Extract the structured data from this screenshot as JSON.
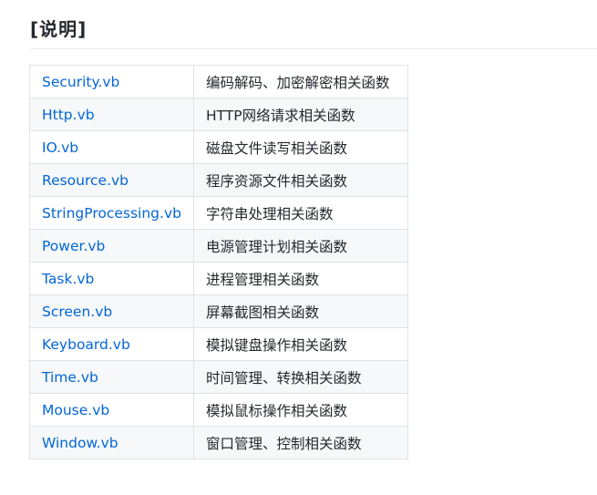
{
  "section": {
    "title": "[说明]"
  },
  "table": {
    "rows": [
      {
        "file": "Security.vb",
        "desc": "编码解码、加密解密相关函数"
      },
      {
        "file": "Http.vb",
        "desc": "HTTP网络请求相关函数"
      },
      {
        "file": "IO.vb",
        "desc": "磁盘文件读写相关函数"
      },
      {
        "file": "Resource.vb",
        "desc": "程序资源文件相关函数"
      },
      {
        "file": "StringProcessing.vb",
        "desc": "字符串处理相关函数"
      },
      {
        "file": "Power.vb",
        "desc": "电源管理计划相关函数"
      },
      {
        "file": "Task.vb",
        "desc": "进程管理相关函数"
      },
      {
        "file": "Screen.vb",
        "desc": "屏幕截图相关函数"
      },
      {
        "file": "Keyboard.vb",
        "desc": "模拟键盘操作相关函数"
      },
      {
        "file": "Time.vb",
        "desc": "时间管理、转换相关函数"
      },
      {
        "file": "Mouse.vb",
        "desc": "模拟鼠标操作相关函数"
      },
      {
        "file": "Window.vb",
        "desc": "窗口管理、控制相关函数"
      }
    ]
  },
  "colors": {
    "link": "#0366d6",
    "text": "#24292e",
    "border": "#dfe2e5",
    "stripe": "#f6f8fa"
  }
}
